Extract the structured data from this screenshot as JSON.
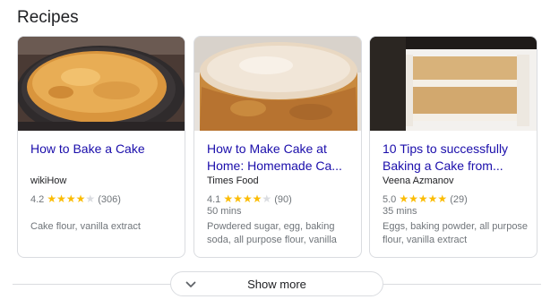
{
  "section": {
    "title": "Recipes"
  },
  "recipes": [
    {
      "title_line1": "How to Bake a Cake",
      "title_line2": "",
      "source": "wikiHow",
      "rating": "4.2",
      "stars": "★★★★",
      "stars_off": "★",
      "reviews": "(306)",
      "time": "",
      "ingredients": "Cake flour, vanilla extract",
      "thumbnail_icon": "baked-cake-in-pan-image"
    },
    {
      "title_line1": "How to Make Cake at",
      "title_line2": "Home: Homemade Ca...",
      "source": "Times Food",
      "rating": "4.1",
      "stars": "★★★★",
      "stars_off": "★",
      "reviews": "(90)",
      "time": "50 mins",
      "ingredients": "Powdered sugar, egg, baking soda, all purpose flour, vanilla",
      "thumbnail_icon": "sponge-cake-image"
    },
    {
      "title_line1": "10 Tips to successfully",
      "title_line2": "Baking a Cake from...",
      "source": "Veena Azmanov",
      "rating": "5.0",
      "stars": "★★★★★",
      "stars_off": "",
      "reviews": "(29)",
      "time": "35 mins",
      "ingredients": "Eggs, baking powder, all purpose flour, vanilla extract",
      "thumbnail_icon": "layered-cake-slice-image"
    }
  ],
  "show_more": {
    "label": "Show more",
    "icon": "chevron-down-icon"
  },
  "colors": {
    "link": "#1a0dab",
    "star": "#fbbc04",
    "muted": "#70757a",
    "border": "#dadce0"
  }
}
